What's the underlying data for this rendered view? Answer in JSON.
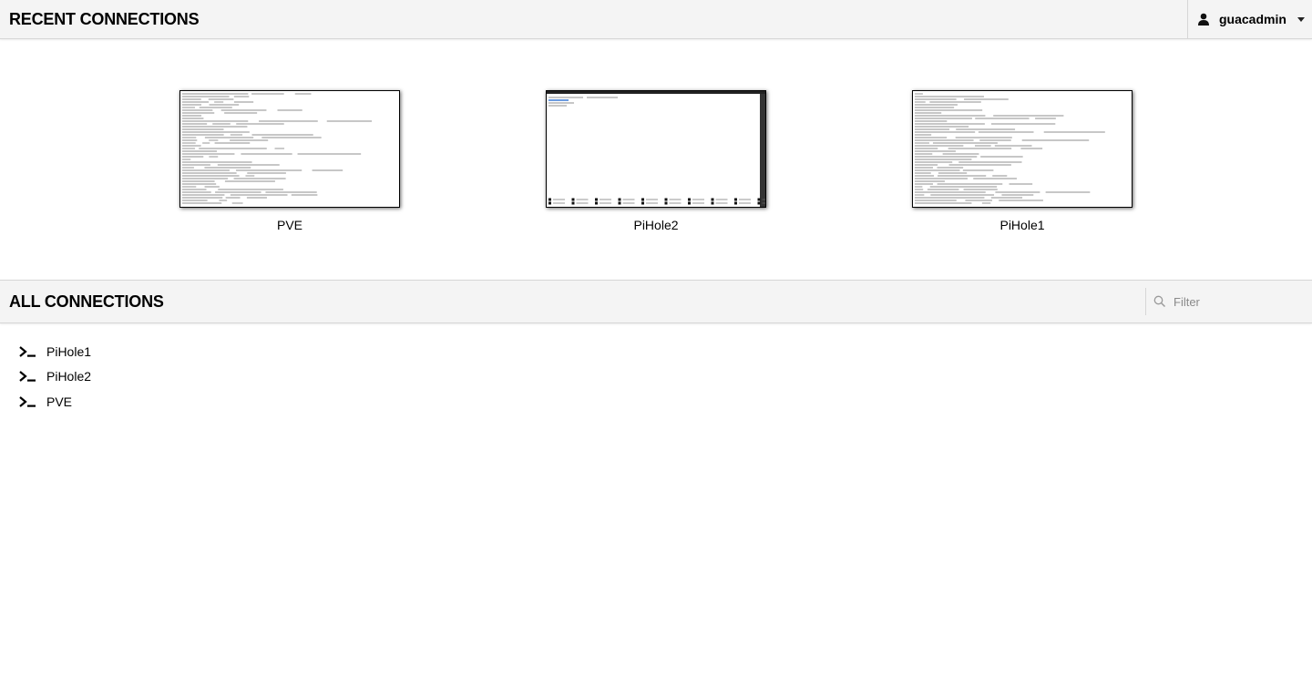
{
  "recent_section": {
    "title": "RECENT CONNECTIONS",
    "items": [
      {
        "name": "PVE",
        "thumbnail": "terminal-screenshot-dense-text"
      },
      {
        "name": "PiHole2",
        "thumbnail": "terminal-screenshot-nano-editor"
      },
      {
        "name": "PiHole1",
        "thumbnail": "terminal-screenshot-dense-text"
      }
    ]
  },
  "user_menu": {
    "username": "guacadmin",
    "icon": "user-icon",
    "caret_icon": "chevron-down-icon"
  },
  "all_section": {
    "title": "ALL CONNECTIONS",
    "filter": {
      "placeholder": "Filter",
      "value": "",
      "icon": "search-icon"
    },
    "connections": [
      {
        "name": "PiHole1",
        "icon": "terminal-prompt-icon"
      },
      {
        "name": "PiHole2",
        "icon": "terminal-prompt-icon"
      },
      {
        "name": "PVE",
        "icon": "terminal-prompt-icon"
      }
    ]
  },
  "colors": {
    "header_bg": "#f4f4f4",
    "border": "#d6d6d6",
    "text": "#000000",
    "placeholder": "#8a8a8a"
  }
}
